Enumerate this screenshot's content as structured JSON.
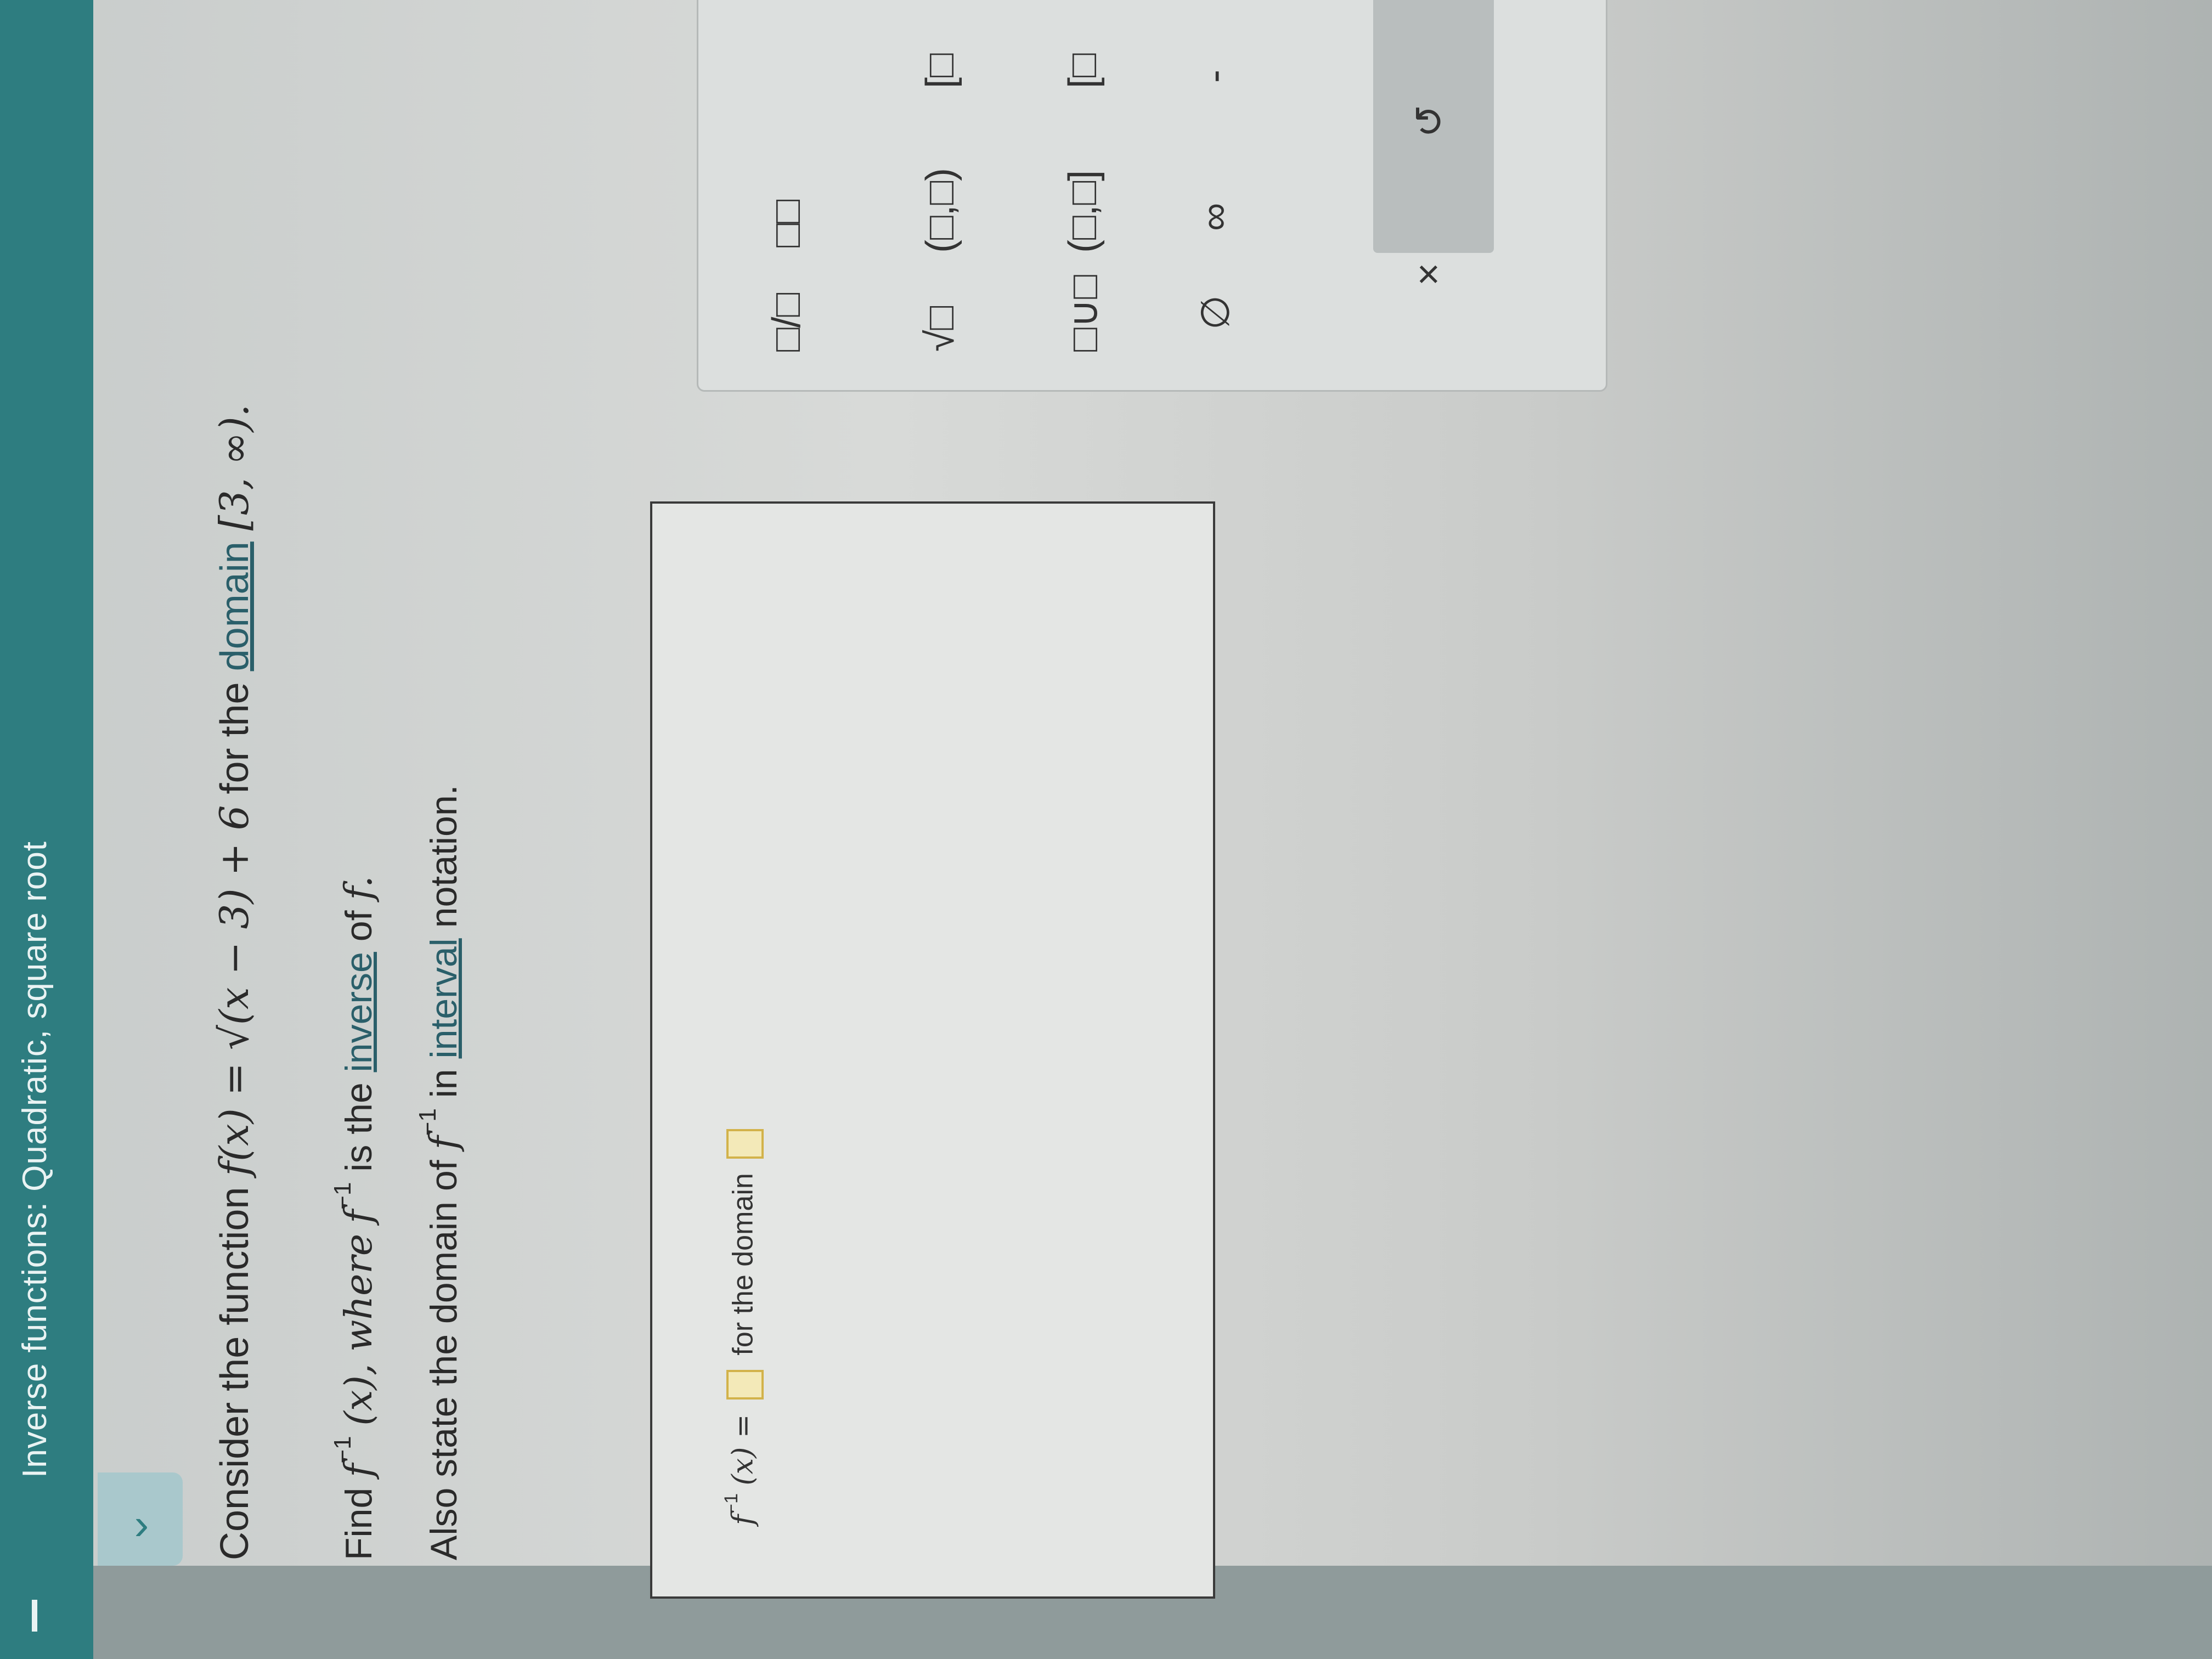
{
  "header": {
    "title": "Inverse functions: Quadratic, square root"
  },
  "question": {
    "line1_prefix": "Consider the function",
    "line1_function": "f(x) = √(x − 3) + 6",
    "line1_mid": "for the",
    "line1_link": "domain",
    "line1_interval": "[3, ∞).",
    "line2_prefix": "Find",
    "line2_func": "f",
    "line2_sup": "−1",
    "line2_arg": "(x), where",
    "line2_f2": "f",
    "line2_sup2": "−1",
    "line2_mid": "is the",
    "line2_link": "inverse",
    "line2_suffix": "of",
    "line2_f3": "f.",
    "line3_prefix": "Also state the domain of",
    "line3_f": "f",
    "line3_sup": "−1",
    "line3_mid": "in",
    "line3_link": "interval",
    "line3_suffix": "notation."
  },
  "answer": {
    "lhs_f": "f",
    "lhs_sup": "−1",
    "lhs_arg": "(x) =",
    "middle_text": "for the domain"
  },
  "keypad": {
    "fraction": "□/□",
    "power": "□□",
    "nthroot": "√□",
    "open_interval": "(□,□)",
    "union": "□∪□",
    "half_open": "(□,□]",
    "empty_set": "∅",
    "infinity": "∞",
    "neg": "-",
    "clear": "×",
    "undo": "↺",
    "partial_right_1": "[□",
    "partial_right_2": "[□"
  }
}
